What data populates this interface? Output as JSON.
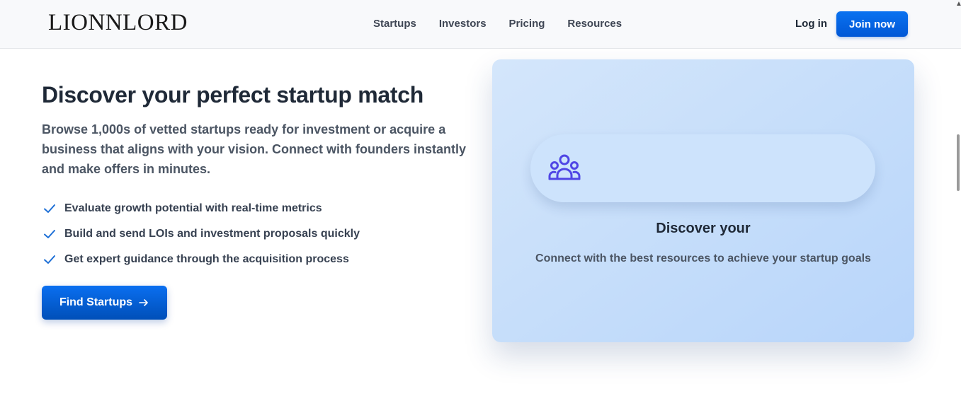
{
  "header": {
    "logo": "LIONNLORD",
    "nav": [
      "Startups",
      "Investors",
      "Pricing",
      "Resources"
    ],
    "login_label": "Log in",
    "join_label": "Join now"
  },
  "hero": {
    "title": "Discover your perfect startup match",
    "description": "Browse 1,000s of vetted startups ready for investment or acquire a business that aligns with your vision. Connect with founders instantly and make offers in minutes.",
    "features": [
      "Evaluate growth potential with real-time metrics",
      "Build and send LOIs and investment proposals quickly",
      "Get expert guidance through the acquisition process"
    ],
    "cta_label": "Find Startups"
  },
  "card": {
    "icon": "users-icon",
    "title": "Discover your",
    "subtitle": "Connect with the best resources to achieve your startup goals"
  },
  "colors": {
    "accent": "#0a72f0",
    "check": "#1d6fd6",
    "icon": "#4f46e5",
    "card_bg": "#c8dffb"
  }
}
